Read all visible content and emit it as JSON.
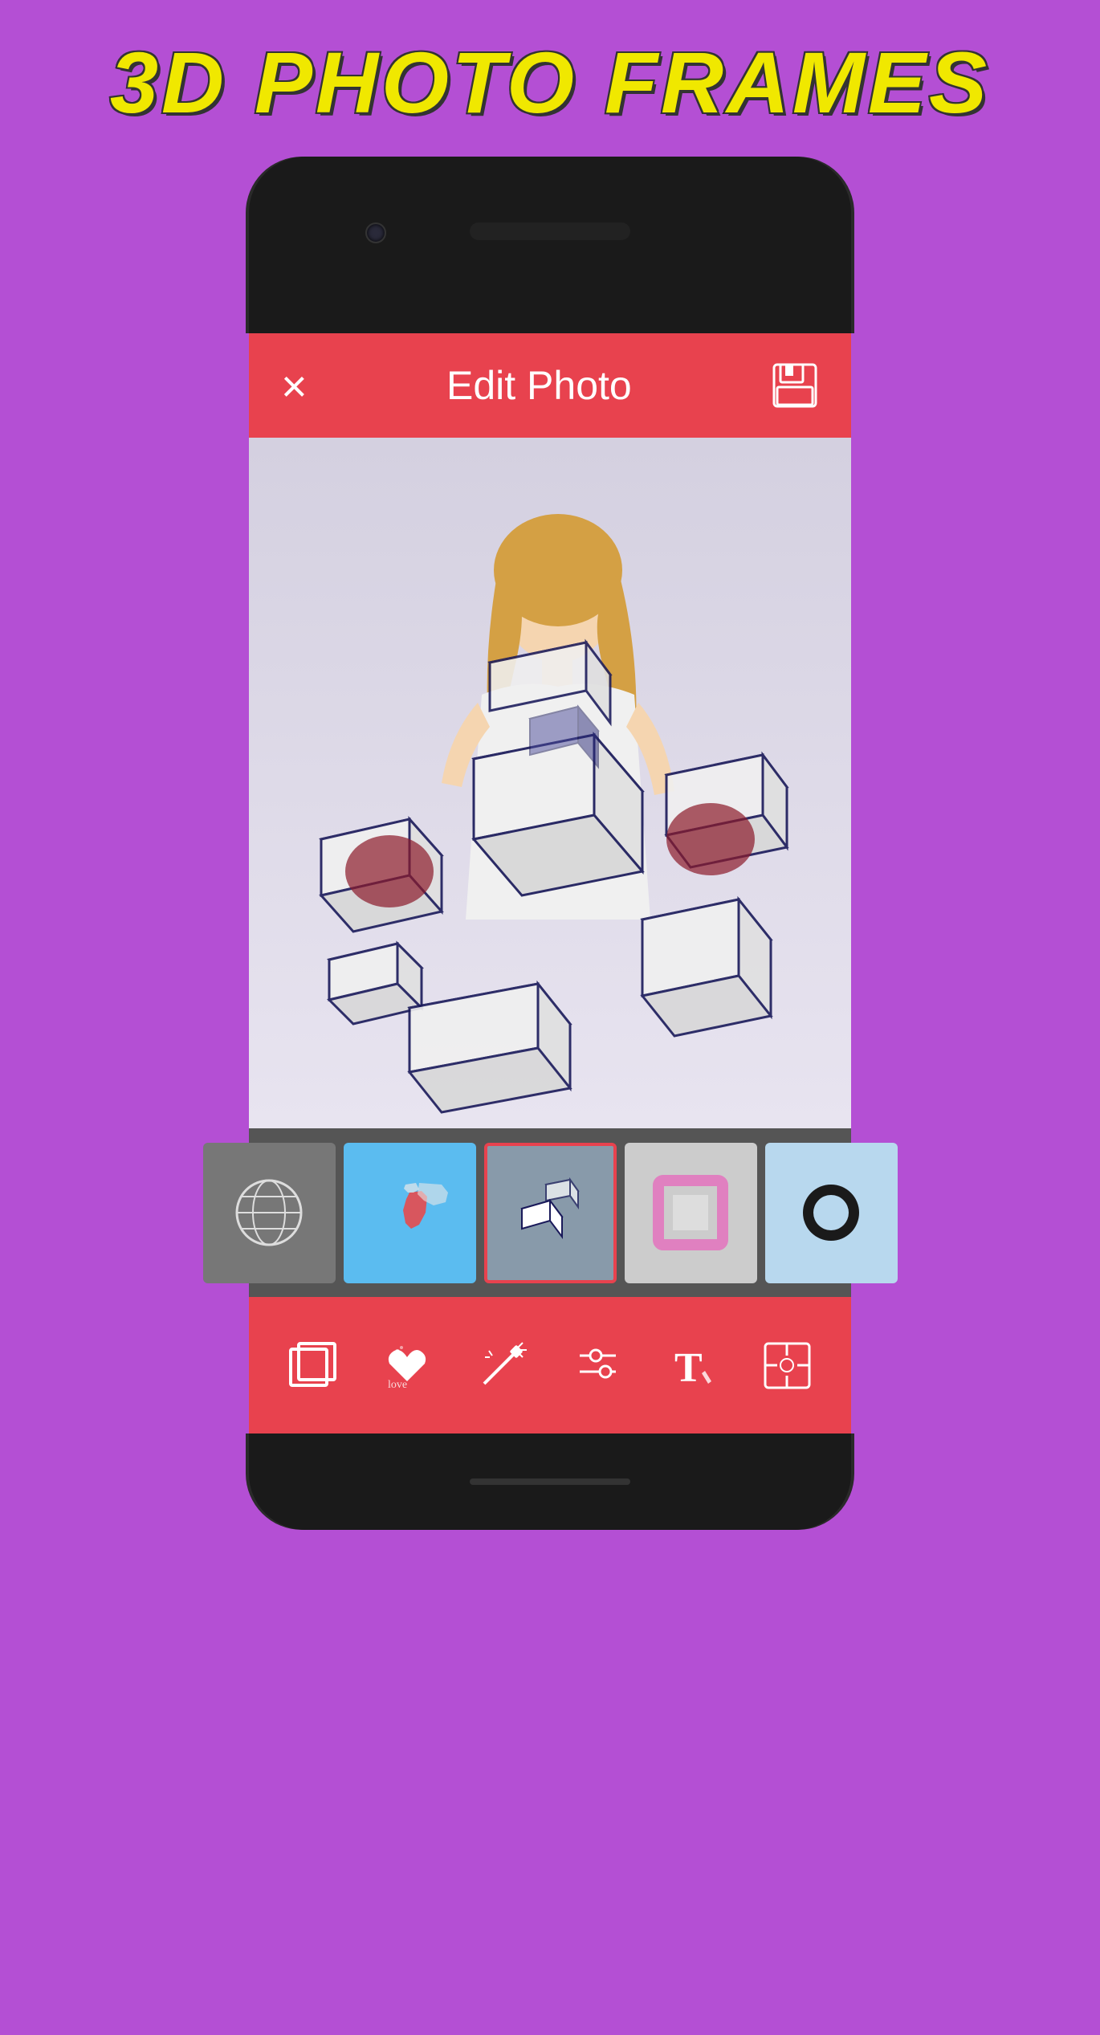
{
  "app": {
    "title": "3D PHOTO FRAMES",
    "title_color": "#f0e800",
    "background_color": "#b44fd4"
  },
  "header": {
    "close_label": "×",
    "title": "Edit Photo",
    "save_icon": "💾",
    "bar_color": "#e8424e"
  },
  "thumbnails": [
    {
      "id": "globe",
      "type": "globe",
      "bg": "#888",
      "active": false
    },
    {
      "id": "map",
      "type": "map",
      "bg": "#5bbcf0",
      "active": false
    },
    {
      "id": "3d-boxes",
      "type": "3d",
      "bg": "#8899aa",
      "active": true
    },
    {
      "id": "pink-frame",
      "type": "pink",
      "bg": "#cccccc",
      "active": false
    },
    {
      "id": "circle",
      "type": "circle",
      "bg": "#b8d8ee",
      "active": false
    }
  ],
  "tools": [
    {
      "id": "frames",
      "icon": "🖼",
      "label": "frames"
    },
    {
      "id": "stickers",
      "icon": "♥",
      "label": "stickers"
    },
    {
      "id": "magic",
      "icon": "✨",
      "label": "magic"
    },
    {
      "id": "adjust",
      "icon": "⚙",
      "label": "adjust"
    },
    {
      "id": "text",
      "icon": "T",
      "label": "text"
    },
    {
      "id": "focus",
      "icon": "⊕",
      "label": "focus"
    }
  ]
}
